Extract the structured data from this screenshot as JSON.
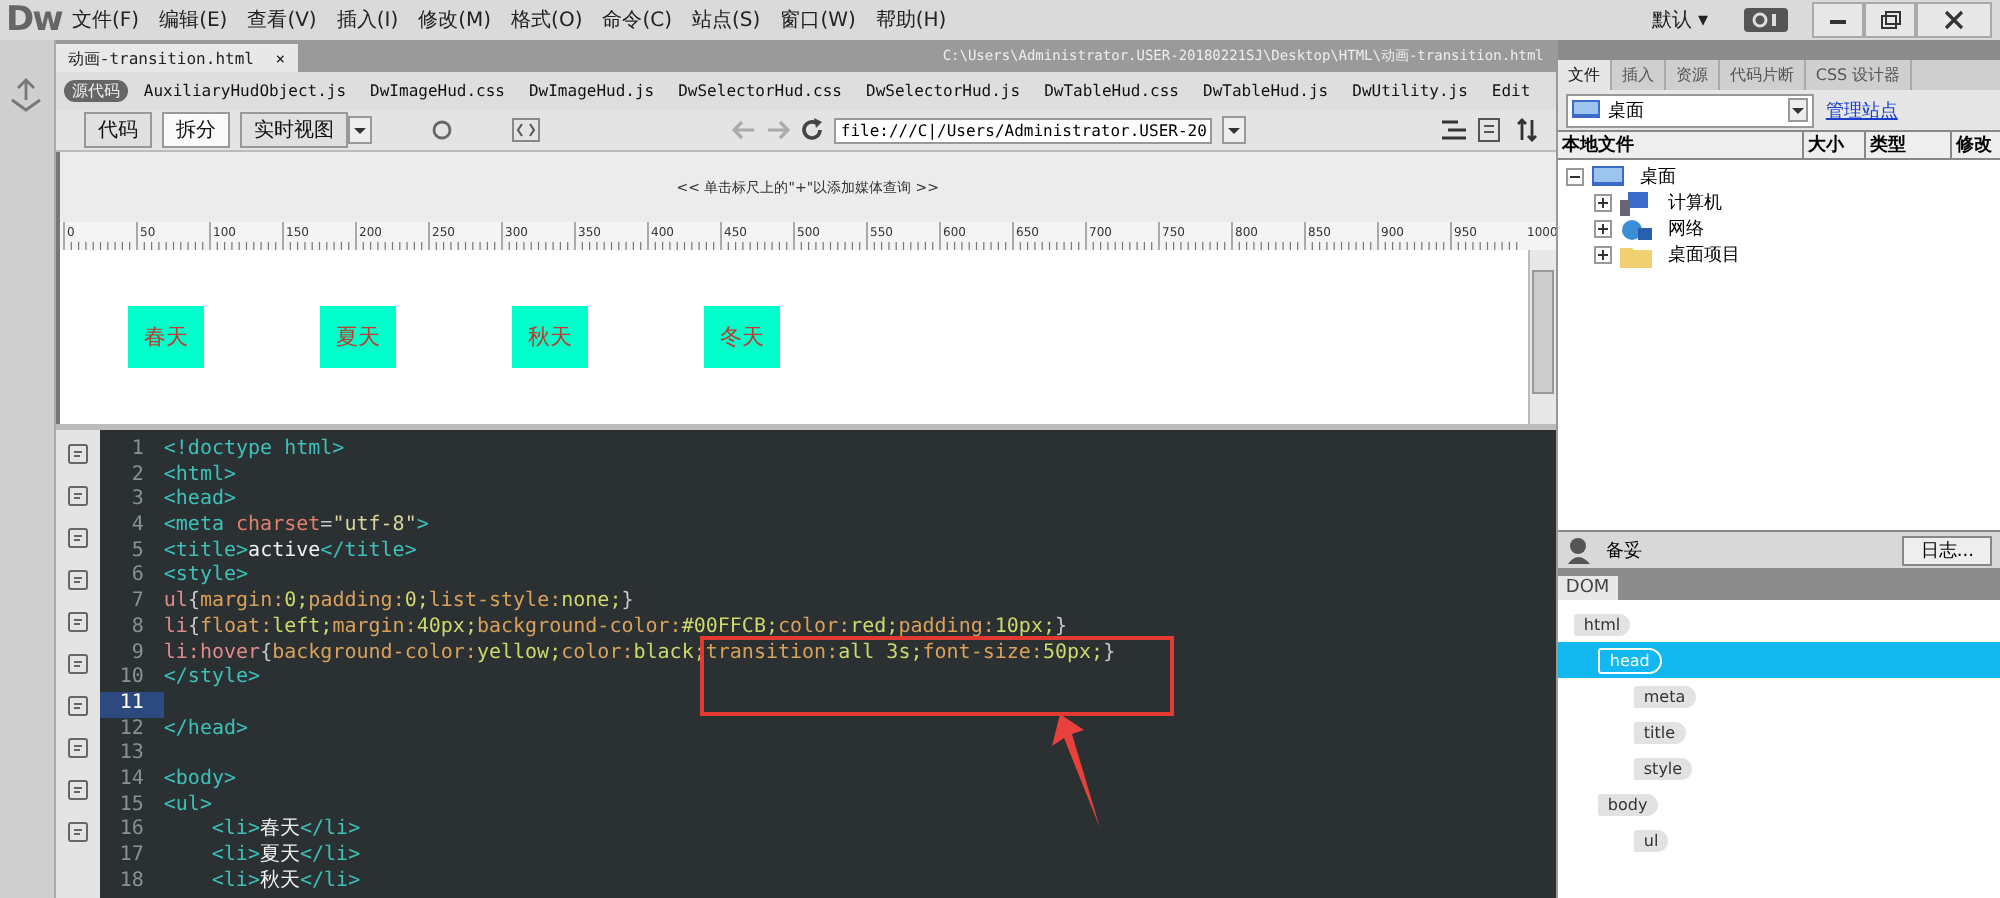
{
  "app": {
    "logo": "Dw",
    "menu": [
      "文件(F)",
      "编辑(E)",
      "查看(V)",
      "插入(I)",
      "修改(M)",
      "格式(O)",
      "命令(C)",
      "站点(S)",
      "窗口(W)",
      "帮助(H)"
    ],
    "workspace": "默认",
    "workspace_caret": "▾"
  },
  "document": {
    "tab": {
      "label": "动画-transition.html",
      "close": "×",
      "selected": true
    },
    "path": "C:\\Users\\Administrator.USER-20180221SJ\\Desktop\\HTML\\动画-transition.html",
    "related_files": [
      {
        "label": "源代码",
        "selected": true
      },
      {
        "label": "AuxiliaryHudObject.js",
        "selected": false
      },
      {
        "label": "DwImageHud.css",
        "selected": false
      },
      {
        "label": "DwImageHud.js",
        "selected": false
      },
      {
        "label": "DwSelectorHud.css",
        "selected": false
      },
      {
        "label": "DwSelectorHud.js",
        "selected": false
      },
      {
        "label": "DwTableHud.css",
        "selected": false
      },
      {
        "label": "DwTableHud.js",
        "selected": false
      },
      {
        "label": "DwUtility.js",
        "selected": false
      },
      {
        "label": "Edit",
        "selected": false
      }
    ],
    "view_buttons": [
      {
        "label": "代码",
        "selected": false
      },
      {
        "label": "拆分",
        "selected": true
      },
      {
        "label": "实时视图",
        "selected": false
      }
    ],
    "address": "file:///C|/Users/Administrator.USER-20",
    "media_query_hint": "<< 单击标尺上的\"+\"以添加媒体查询 >>",
    "ruler_labels": [
      "0",
      "50",
      "100",
      "150",
      "200",
      "250",
      "300",
      "350",
      "400",
      "450",
      "500",
      "550",
      "600",
      "650",
      "700",
      "750",
      "800",
      "850",
      "900",
      "950",
      "1000"
    ],
    "preview_items": [
      "春天",
      "夏天",
      "秋天",
      "冬天"
    ],
    "code_lines": [
      {
        "number": "1",
        "current": false,
        "tokens": [
          {
            "text": "<!doctype html>",
            "kind": "tag"
          }
        ]
      },
      {
        "number": "2",
        "current": false,
        "tokens": [
          {
            "text": "<html>",
            "kind": "tag"
          }
        ]
      },
      {
        "number": "3",
        "current": false,
        "tokens": [
          {
            "text": "<head>",
            "kind": "tag"
          }
        ]
      },
      {
        "number": "4",
        "current": false,
        "tokens": [
          {
            "text": "<meta ",
            "kind": "tag"
          },
          {
            "text": "charset",
            "kind": "attr"
          },
          {
            "text": "=",
            "kind": "punct"
          },
          {
            "text": "\"utf-8\"",
            "kind": "str"
          },
          {
            "text": ">",
            "kind": "tag"
          }
        ]
      },
      {
        "number": "5",
        "current": false,
        "tokens": [
          {
            "text": "<title>",
            "kind": "tag"
          },
          {
            "text": "active",
            "kind": "text"
          },
          {
            "text": "</title>",
            "kind": "tag"
          }
        ]
      },
      {
        "number": "6",
        "current": false,
        "tokens": [
          {
            "text": "<style>",
            "kind": "tag"
          }
        ]
      },
      {
        "number": "7",
        "current": false,
        "tokens": [
          {
            "text": "ul",
            "kind": "sel"
          },
          {
            "text": "{",
            "kind": "punct"
          },
          {
            "text": "margin:",
            "kind": "prop"
          },
          {
            "text": "0;",
            "kind": "val"
          },
          {
            "text": "padding:",
            "kind": "prop"
          },
          {
            "text": "0;",
            "kind": "val"
          },
          {
            "text": "list-style:",
            "kind": "prop"
          },
          {
            "text": "none;",
            "kind": "val"
          },
          {
            "text": "}",
            "kind": "punct"
          }
        ]
      },
      {
        "number": "8",
        "current": false,
        "tokens": [
          {
            "text": "li",
            "kind": "sel"
          },
          {
            "text": "{",
            "kind": "punct"
          },
          {
            "text": "float:",
            "kind": "prop"
          },
          {
            "text": "left;",
            "kind": "val"
          },
          {
            "text": "margin:",
            "kind": "prop"
          },
          {
            "text": "40px;",
            "kind": "val"
          },
          {
            "text": "background-color:",
            "kind": "prop"
          },
          {
            "text": "#00FFCB;",
            "kind": "val"
          },
          {
            "text": "color:",
            "kind": "prop"
          },
          {
            "text": "red;",
            "kind": "val"
          },
          {
            "text": "padding:",
            "kind": "prop"
          },
          {
            "text": "10px;",
            "kind": "val"
          },
          {
            "text": "}",
            "kind": "punct"
          }
        ]
      },
      {
        "number": "9",
        "current": false,
        "tokens": [
          {
            "text": "li:hover",
            "kind": "sel"
          },
          {
            "text": "{",
            "kind": "punct"
          },
          {
            "text": "background-color:",
            "kind": "prop"
          },
          {
            "text": "yellow;",
            "kind": "val"
          },
          {
            "text": "color:",
            "kind": "prop"
          },
          {
            "text": "black;",
            "kind": "val"
          },
          {
            "text": "transition:",
            "kind": "prop"
          },
          {
            "text": "all 3s;",
            "kind": "val"
          },
          {
            "text": "font-size:",
            "kind": "prop"
          },
          {
            "text": "50px;",
            "kind": "val"
          },
          {
            "text": "}",
            "kind": "punct"
          }
        ]
      },
      {
        "number": "10",
        "current": false,
        "tokens": [
          {
            "text": "</style>",
            "kind": "tag"
          }
        ]
      },
      {
        "number": "11",
        "current": true
      },
      {
        "number": "12",
        "current": false,
        "tokens": [
          {
            "text": "</head>",
            "kind": "tag"
          }
        ]
      },
      {
        "number": "13",
        "current": false
      },
      {
        "number": "14",
        "current": false,
        "tokens": [
          {
            "text": "<body>",
            "kind": "tag"
          }
        ]
      },
      {
        "number": "15",
        "current": false,
        "tokens": [
          {
            "text": "<ul>",
            "kind": "tag"
          }
        ]
      },
      {
        "number": "16",
        "current": false,
        "indented": true,
        "tokens": [
          {
            "text": "<li>",
            "kind": "tag"
          },
          {
            "text": "春天",
            "kind": "text"
          },
          {
            "text": "</li>",
            "kind": "tag"
          }
        ]
      },
      {
        "number": "17",
        "current": false,
        "indented": true,
        "tokens": [
          {
            "text": "<li>",
            "kind": "tag"
          },
          {
            "text": "夏天",
            "kind": "text"
          },
          {
            "text": "</li>",
            "kind": "tag"
          }
        ]
      },
      {
        "number": "18",
        "current": false,
        "indented": true,
        "tokens": [
          {
            "text": "<li>",
            "kind": "tag"
          },
          {
            "text": "秋天",
            "kind": "text"
          },
          {
            "text": "</li>",
            "kind": "tag"
          }
        ]
      }
    ]
  },
  "files_panel": {
    "tabs": [
      {
        "label": "文件",
        "selected": true
      },
      {
        "label": "插入",
        "selected": false
      },
      {
        "label": "资源",
        "selected": false
      },
      {
        "label": "代码片断",
        "selected": false
      },
      {
        "label": "CSS 设计器",
        "selected": false
      }
    ],
    "site_select": "桌面",
    "manage_link": "管理站点",
    "columns": [
      "本地文件",
      "大小",
      "类型",
      "修改"
    ],
    "tree": [
      {
        "label": "桌面",
        "expanded": true,
        "kind": "monitor",
        "children": [
          {
            "label": "计算机",
            "expanded": false,
            "kind": "computer"
          },
          {
            "label": "网络",
            "expanded": false,
            "kind": "network"
          },
          {
            "label": "桌面项目",
            "expanded": false,
            "kind": "folder"
          }
        ]
      }
    ],
    "status": "备妥",
    "log_button": "日志..."
  },
  "dom_panel": {
    "tab": "DOM",
    "tree": [
      {
        "label": "html",
        "selected": false,
        "children": [
          {
            "label": "head",
            "selected": true,
            "children": [
              {
                "label": "meta",
                "selected": false
              },
              {
                "label": "title",
                "selected": false
              },
              {
                "label": "style",
                "selected": false
              }
            ]
          },
          {
            "label": "body",
            "selected": false,
            "children": [
              {
                "label": "ul",
                "selected": false
              }
            ]
          }
        ]
      }
    ]
  }
}
